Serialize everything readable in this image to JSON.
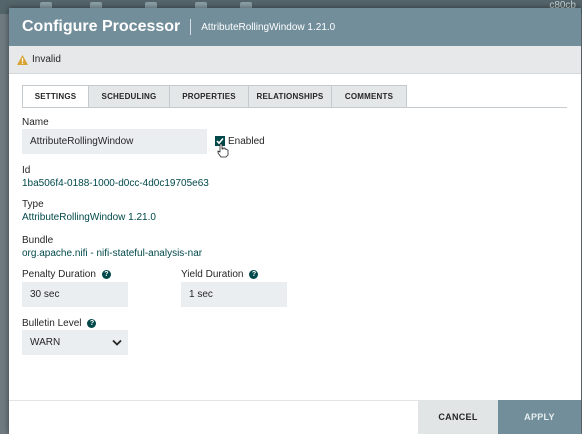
{
  "background": {
    "corner_id": "c80cb"
  },
  "dialog": {
    "title": "Configure Processor",
    "subtitle": "AttributeRollingWindow 1.21.0",
    "status": "Invalid",
    "tabs": [
      {
        "label": "SETTINGS",
        "active": true
      },
      {
        "label": "SCHEDULING",
        "active": false
      },
      {
        "label": "PROPERTIES",
        "active": false
      },
      {
        "label": "RELATIONSHIPS",
        "active": false
      },
      {
        "label": "COMMENTS",
        "active": false
      }
    ],
    "settings": {
      "name_label": "Name",
      "name_value": "AttributeRollingWindow",
      "enabled_label": "Enabled",
      "enabled_checked": true,
      "id_label": "Id",
      "id_value": "1ba506f4-0188-1000-d0cc-4d0c19705e63",
      "type_label": "Type",
      "type_value": "AttributeRollingWindow 1.21.0",
      "bundle_label": "Bundle",
      "bundle_value": "org.apache.nifi - nifi-stateful-analysis-nar",
      "penalty_label": "Penalty Duration",
      "penalty_value": "30 sec",
      "yield_label": "Yield Duration",
      "yield_value": "1 sec",
      "bulletin_label": "Bulletin Level",
      "bulletin_value": "WARN",
      "help_glyph": "?"
    },
    "buttons": {
      "cancel": "CANCEL",
      "apply": "APPLY"
    }
  },
  "colors": {
    "header": "#728e9b",
    "accent": "#004849",
    "warning": "#d7a333"
  },
  "icons": [
    "warning-icon",
    "help-icon",
    "chevron-down-icon",
    "check-icon",
    "hand-cursor-icon"
  ]
}
